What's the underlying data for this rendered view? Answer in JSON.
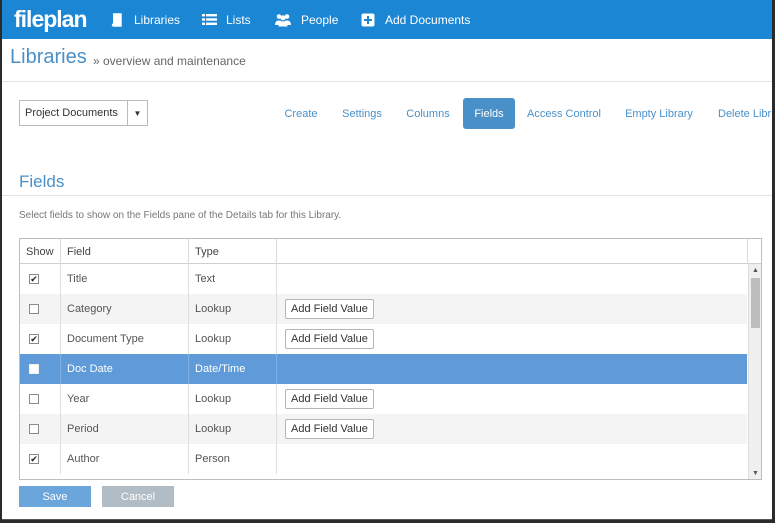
{
  "app": {
    "logo": "fileplan"
  },
  "nav": {
    "items": [
      {
        "label": "Libraries",
        "icon": "book-icon"
      },
      {
        "label": "Lists",
        "icon": "list-icon"
      },
      {
        "label": "People",
        "icon": "people-icon"
      },
      {
        "label": "Add Documents",
        "icon": "plus-square-icon"
      }
    ]
  },
  "header": {
    "title": "Libraries",
    "subtitle": "» overview and maintenance"
  },
  "library_select": {
    "value": "Project Documents"
  },
  "tabs": [
    {
      "label": "Create",
      "active": false
    },
    {
      "label": "Settings",
      "active": false
    },
    {
      "label": "Columns",
      "active": false
    },
    {
      "label": "Fields",
      "active": true
    },
    {
      "label": "Access Control",
      "active": false
    },
    {
      "label": "Empty Library",
      "active": false
    },
    {
      "label": "Delete Libr",
      "active": false
    }
  ],
  "section": {
    "title": "Fields",
    "description": "Select fields to show on the Fields pane of the Details tab for this Library."
  },
  "grid": {
    "columns": [
      "Show",
      "Field",
      "Type"
    ],
    "rows": [
      {
        "checked": true,
        "field": "Title",
        "type": "Text",
        "button": ""
      },
      {
        "checked": false,
        "field": "Category",
        "type": "Lookup",
        "button": "Add Field Value"
      },
      {
        "checked": true,
        "field": "Document Type",
        "type": "Lookup",
        "button": "Add Field Value"
      },
      {
        "checked": false,
        "field": "Doc Date",
        "type": "Date/Time",
        "button": ""
      },
      {
        "checked": false,
        "field": "Year",
        "type": "Lookup",
        "button": "Add Field Value"
      },
      {
        "checked": false,
        "field": "Period",
        "type": "Lookup",
        "button": "Add Field Value"
      },
      {
        "checked": true,
        "field": "Author",
        "type": "Person",
        "button": ""
      }
    ],
    "selected_row": 3
  },
  "actions": {
    "save_label": "Save",
    "cancel_label": "Cancel"
  },
  "colors": {
    "brand": "#1b87d4",
    "accent": "#4a90c8",
    "selected_row": "#5e9bd8"
  }
}
